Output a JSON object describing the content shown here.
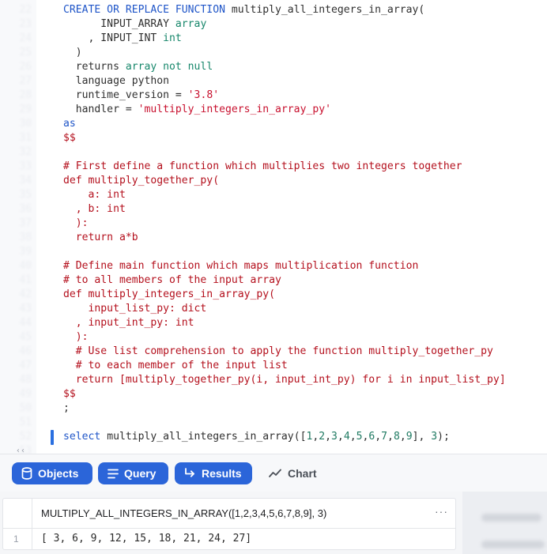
{
  "editor": {
    "line_numbers": [
      "21",
      "22",
      "23",
      "24",
      "25",
      "26",
      "27",
      "28",
      "29",
      "30",
      "31",
      "32",
      "33",
      "34",
      "35",
      "36",
      "37",
      "38",
      "39",
      "40",
      "41",
      "42",
      "43",
      "44",
      "45",
      "46",
      "47",
      "48",
      "49",
      "50",
      "51",
      "52",
      "53",
      "54",
      "55",
      "56"
    ],
    "lines": [
      [
        [
          "k",
          "CREATE OR REPLACE FUNCTION"
        ],
        [
          "plain",
          " multiply_all_integers_in_array("
        ]
      ],
      [
        [
          "plain",
          "      INPUT_ARRAY "
        ],
        [
          "ty",
          "array"
        ]
      ],
      [
        [
          "plain",
          "    , INPUT_INT "
        ],
        [
          "ty",
          "int"
        ]
      ],
      [
        [
          "plain",
          "  )"
        ]
      ],
      [
        [
          "plain",
          "  returns "
        ],
        [
          "ty",
          "array not null"
        ]
      ],
      [
        [
          "plain",
          "  language python"
        ]
      ],
      [
        [
          "plain",
          "  runtime_version = "
        ],
        [
          "s",
          "'3.8'"
        ]
      ],
      [
        [
          "plain",
          "  handler = "
        ],
        [
          "s",
          "'multiply_integers_in_array_py'"
        ]
      ],
      [
        [
          "k",
          "as"
        ]
      ],
      [
        [
          "py",
          "$$"
        ]
      ],
      [
        [
          "plain",
          ""
        ]
      ],
      [
        [
          "py",
          "# First define a function which multiplies two integers together"
        ]
      ],
      [
        [
          "py",
          "def multiply_together_py("
        ]
      ],
      [
        [
          "py",
          "    a: int"
        ]
      ],
      [
        [
          "py",
          "  , b: int"
        ]
      ],
      [
        [
          "py",
          "  ):"
        ]
      ],
      [
        [
          "py",
          "  return a*b"
        ]
      ],
      [
        [
          "plain",
          ""
        ]
      ],
      [
        [
          "py",
          "# Define main function which maps multiplication function"
        ]
      ],
      [
        [
          "py",
          "# to all members of the input array"
        ]
      ],
      [
        [
          "py",
          "def multiply_integers_in_array_py("
        ]
      ],
      [
        [
          "py",
          "    input_list_py: dict"
        ]
      ],
      [
        [
          "py",
          "  , input_int_py: int"
        ]
      ],
      [
        [
          "py",
          "  ):"
        ]
      ],
      [
        [
          "py",
          "  # Use list comprehension to apply the function multiply_together_py"
        ]
      ],
      [
        [
          "py",
          "  # to each member of the input list"
        ]
      ],
      [
        [
          "py",
          "  return [multiply_together_py(i, input_int_py) for i in input_list_py]"
        ]
      ],
      [
        [
          "py",
          "$$"
        ]
      ],
      [
        [
          "plain",
          ";"
        ]
      ],
      [
        [
          "plain",
          ""
        ]
      ],
      [
        [
          "k",
          "select"
        ],
        [
          "plain",
          " multiply_all_integers_in_array(["
        ],
        [
          "n",
          "1"
        ],
        [
          "plain",
          ","
        ],
        [
          "n",
          "2"
        ],
        [
          "plain",
          ","
        ],
        [
          "n",
          "3"
        ],
        [
          "plain",
          ","
        ],
        [
          "n",
          "4"
        ],
        [
          "plain",
          ","
        ],
        [
          "n",
          "5"
        ],
        [
          "plain",
          ","
        ],
        [
          "n",
          "6"
        ],
        [
          "plain",
          ","
        ],
        [
          "n",
          "7"
        ],
        [
          "plain",
          ","
        ],
        [
          "n",
          "8"
        ],
        [
          "plain",
          ","
        ],
        [
          "n",
          "9"
        ],
        [
          "plain",
          "], "
        ],
        [
          "n",
          "3"
        ],
        [
          "plain",
          ");"
        ]
      ]
    ],
    "trailing_fragment": "‹‹"
  },
  "toolbar": {
    "objects_label": "Objects",
    "query_label": "Query",
    "results_label": "Results",
    "chart_label": "Chart"
  },
  "results": {
    "column_header": "MULTIPLY_ALL_INTEGERS_IN_ARRAY([1,2,3,4,5,6,7,8,9], 3)",
    "column_menu": "···",
    "rows": [
      {
        "index": "1",
        "value": "[ 3, 6, 9, 12, 15, 18, 21, 24, 27]"
      }
    ]
  },
  "colors": {
    "accent": "#2b65d9",
    "keyword": "#1f55c8",
    "type": "#17876b",
    "string": "#c8102e",
    "python": "#b4101d"
  }
}
